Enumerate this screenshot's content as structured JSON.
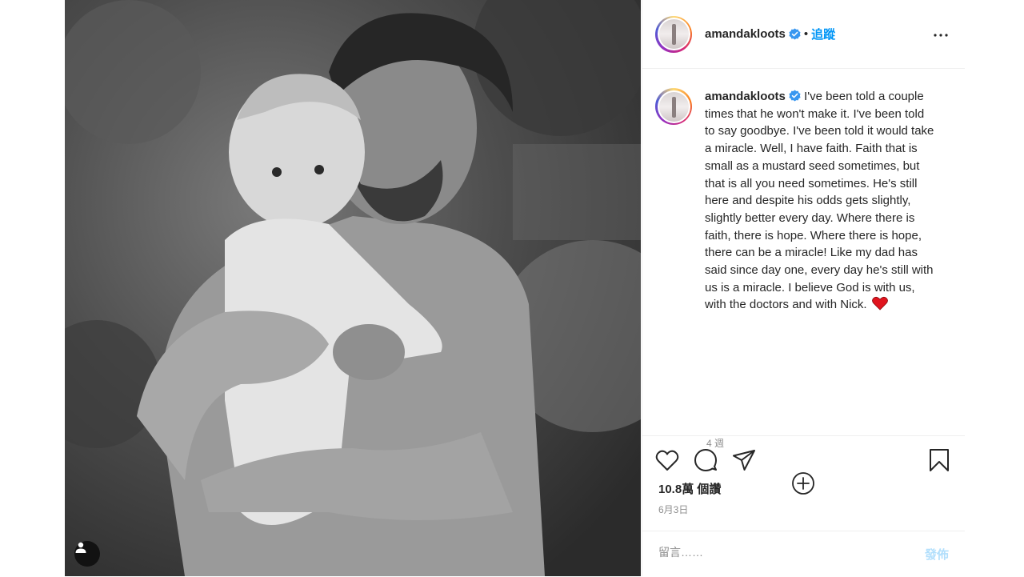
{
  "post": {
    "username": "amandakloots",
    "verified": true,
    "follow_label": "追蹤",
    "more_icon": "more-horizontal-icon",
    "caption": "I've been told a couple times that he won't make it. I've been told to say goodbye. I've been told it would take a miracle. Well, I have faith. Faith that is small as a mustard seed sometimes, but that is all you need sometimes. He's still here and despite his odds gets slightly, slightly better every day. Where there is faith, there is hope. Where there is hope, there can be a miracle! Like my dad has said since day one, every day he's still with us is a miracle. I believe God is with us, with the doctors and with Nick.",
    "caption_emoji": "red-heart-icon",
    "time_ago": "4 週",
    "likes": "10.8萬 個讚",
    "date": "6月3日",
    "comment_placeholder": "留言……",
    "post_label": "發佈"
  },
  "icons": {
    "like": "heart-icon",
    "comment": "comment-icon",
    "share": "share-icon",
    "save": "bookmark-icon",
    "load_more": "plus-circle-icon",
    "user_tags": "user-tag-icon"
  },
  "colors": {
    "accent": "#0095f6",
    "verified": "#3897f0",
    "muted": "#8e8e8e",
    "post_disabled": "#b2dffc",
    "heart": "#e0141e"
  }
}
